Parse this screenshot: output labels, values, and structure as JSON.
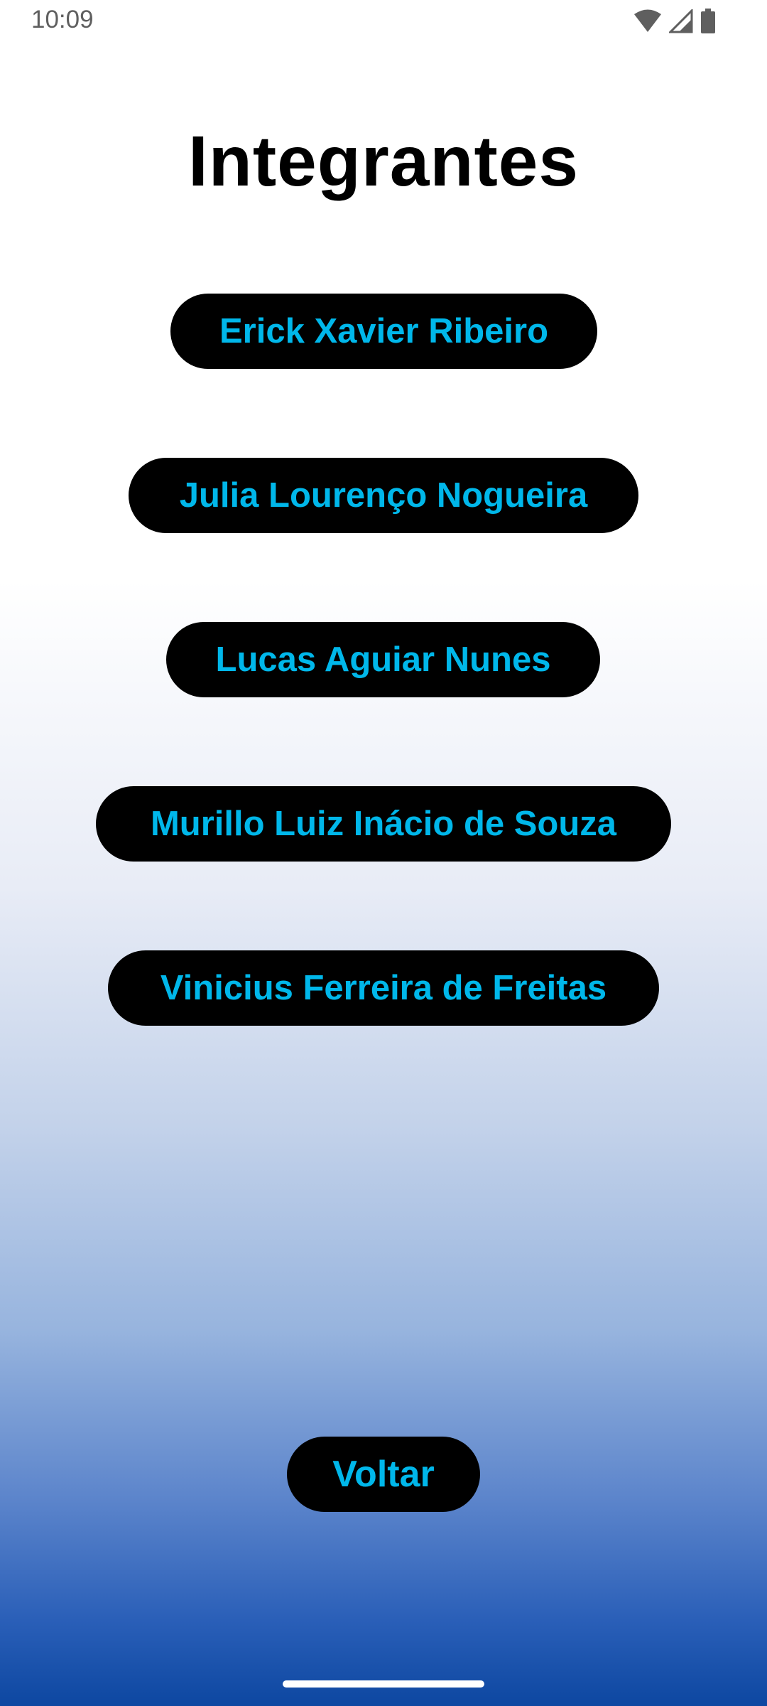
{
  "status_bar": {
    "time": "10:09",
    "icons": [
      "wifi-icon",
      "cell-signal-icon",
      "battery-icon"
    ]
  },
  "page": {
    "title": "Integrantes"
  },
  "members": [
    {
      "label": "Erick Xavier Ribeiro"
    },
    {
      "label": "Julia Lourenço Nogueira"
    },
    {
      "label": "Lucas Aguiar Nunes"
    },
    {
      "label": "Murillo Luiz Inácio de Souza"
    },
    {
      "label": "Vinicius Ferreira de Freitas"
    }
  ],
  "back_button": {
    "label": "Voltar"
  },
  "colors": {
    "button_background": "#000000",
    "button_text": "#00b7ea",
    "title_text": "#000000",
    "gradient_top": "#ffffff",
    "gradient_bottom": "#0d47a1"
  }
}
